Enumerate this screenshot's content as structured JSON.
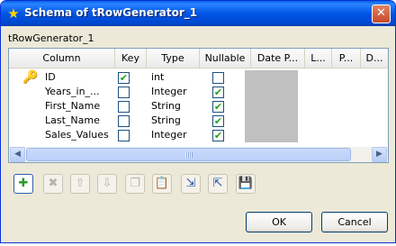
{
  "window": {
    "title": "Schema of tRowGenerator_1",
    "close_glyph": "✕"
  },
  "section_label": "tRowGenerator_1",
  "table": {
    "columns": [
      "Column",
      "Key",
      "Type",
      "Nullable",
      "Date P...",
      "L...",
      "P...",
      "D..."
    ],
    "rows": [
      {
        "column": "ID",
        "key": true,
        "type": "int",
        "nullable": false
      },
      {
        "column": "Years_in_...",
        "key": false,
        "type": "Integer",
        "nullable": true
      },
      {
        "column": "First_Name",
        "key": false,
        "type": "String",
        "nullable": true
      },
      {
        "column": "Last_Name",
        "key": false,
        "type": "String",
        "nullable": true
      },
      {
        "column": "Sales_Values",
        "key": false,
        "type": "Integer",
        "nullable": true
      }
    ]
  },
  "toolbar": [
    {
      "icon": "add-icon",
      "enabled": true
    },
    {
      "icon": "remove-icon",
      "enabled": false
    },
    {
      "icon": "move-up-icon",
      "enabled": false
    },
    {
      "icon": "move-down-icon",
      "enabled": false
    },
    {
      "icon": "copy-icon",
      "enabled": false
    },
    {
      "icon": "paste-icon",
      "enabled": false
    },
    {
      "icon": "import-schema-icon",
      "enabled": true
    },
    {
      "icon": "export-schema-icon",
      "enabled": true
    },
    {
      "icon": "save-icon",
      "enabled": true
    }
  ],
  "buttons": {
    "ok": "OK",
    "cancel": "Cancel"
  },
  "colors": {
    "titlebar": "#0055e5",
    "dialog_bg": "#ece9d8",
    "date_pattern_cell": "#c0c0c0",
    "check": "#21a121"
  }
}
